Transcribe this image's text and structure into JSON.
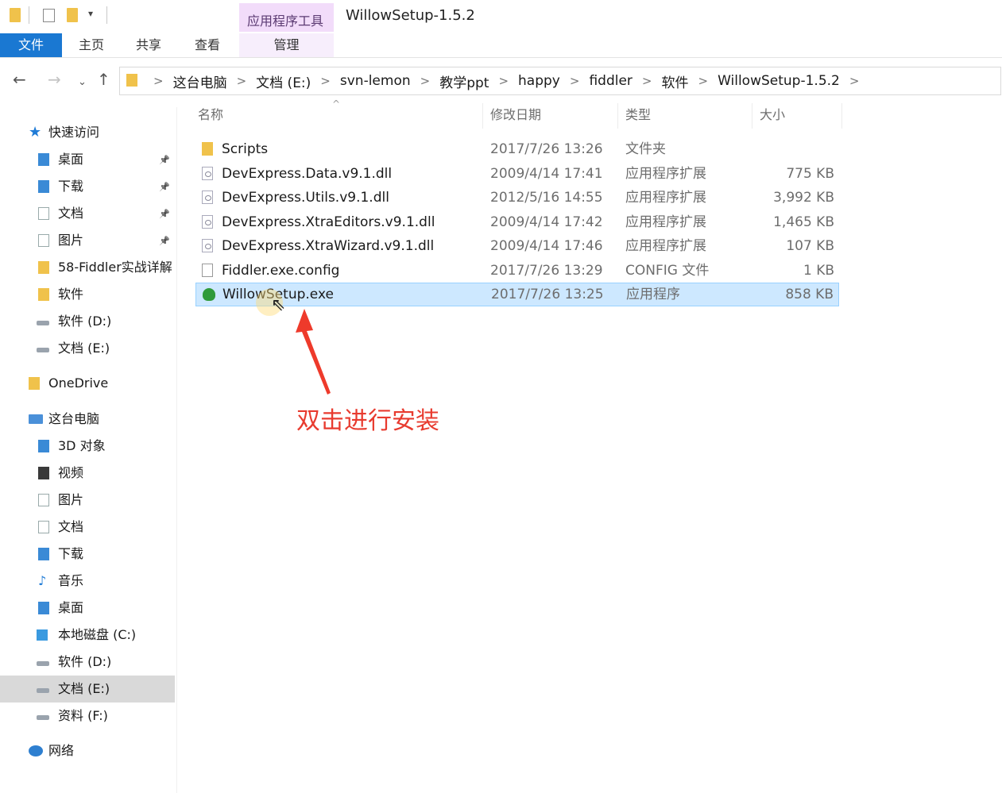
{
  "window": {
    "title": "WillowSetup-1.5.2",
    "context_tab_group": "应用程序工具"
  },
  "ribbon": {
    "tabs": [
      "文件",
      "主页",
      "共享",
      "查看",
      "管理"
    ],
    "active_tab_color": "#1a78d2",
    "context_color": "#f2dcfa"
  },
  "address": {
    "breadcrumbs": [
      "这台电脑",
      "文档 (E:)",
      "svn-lemon",
      "教学ppt",
      "happy",
      "fiddler",
      "软件",
      "WillowSetup-1.5.2"
    ]
  },
  "sidebar": {
    "items": [
      {
        "label": "快速访问",
        "icon": "star-icon"
      },
      {
        "label": "桌面",
        "icon": "desktop-folder-icon",
        "pinned": true
      },
      {
        "label": "下载",
        "icon": "download-folder-icon",
        "pinned": true
      },
      {
        "label": "文档",
        "icon": "documents-folder-icon",
        "pinned": true
      },
      {
        "label": "图片",
        "icon": "pictures-folder-icon",
        "pinned": true
      },
      {
        "label": "58-Fiddler实战详解",
        "icon": "folder-icon"
      },
      {
        "label": "软件",
        "icon": "folder-icon"
      },
      {
        "label": "软件 (D:)",
        "icon": "drive-icon"
      },
      {
        "label": "文档 (E:)",
        "icon": "drive-icon"
      },
      {
        "label": "OneDrive",
        "icon": "onedrive-icon"
      },
      {
        "label": "这台电脑",
        "icon": "computer-icon"
      },
      {
        "label": "3D 对象",
        "icon": "3d-objects-icon"
      },
      {
        "label": "视频",
        "icon": "videos-icon"
      },
      {
        "label": "图片",
        "icon": "pictures-folder-icon"
      },
      {
        "label": "文档",
        "icon": "documents-folder-icon"
      },
      {
        "label": "下载",
        "icon": "download-folder-icon"
      },
      {
        "label": "音乐",
        "icon": "music-icon"
      },
      {
        "label": "桌面",
        "icon": "desktop-folder-icon"
      },
      {
        "label": "本地磁盘 (C:)",
        "icon": "windows-drive-icon"
      },
      {
        "label": "软件 (D:)",
        "icon": "drive-icon"
      },
      {
        "label": "文档 (E:)",
        "icon": "drive-icon",
        "selected": true
      },
      {
        "label": "资料 (F:)",
        "icon": "drive-icon"
      },
      {
        "label": "网络",
        "icon": "network-icon"
      }
    ]
  },
  "file_list": {
    "columns": [
      "名称",
      "修改日期",
      "类型",
      "大小"
    ],
    "rows": [
      {
        "name": "Scripts",
        "date": "2017/7/26 13:26",
        "type": "文件夹",
        "size": "",
        "icon": "folder-icon"
      },
      {
        "name": "DevExpress.Data.v9.1.dll",
        "date": "2009/4/14 17:41",
        "type": "应用程序扩展",
        "size": "775 KB",
        "icon": "dll-file-icon"
      },
      {
        "name": "DevExpress.Utils.v9.1.dll",
        "date": "2012/5/16 14:55",
        "type": "应用程序扩展",
        "size": "3,992 KB",
        "icon": "dll-file-icon"
      },
      {
        "name": "DevExpress.XtraEditors.v9.1.dll",
        "date": "2009/4/14 17:42",
        "type": "应用程序扩展",
        "size": "1,465 KB",
        "icon": "dll-file-icon"
      },
      {
        "name": "DevExpress.XtraWizard.v9.1.dll",
        "date": "2009/4/14 17:46",
        "type": "应用程序扩展",
        "size": "107 KB",
        "icon": "dll-file-icon"
      },
      {
        "name": "Fiddler.exe.config",
        "date": "2017/7/26 13:29",
        "type": "CONFIG 文件",
        "size": "1 KB",
        "icon": "config-file-icon"
      },
      {
        "name": "WillowSetup.exe",
        "date": "2017/7/26 13:25",
        "type": "应用程序",
        "size": "858 KB",
        "icon": "exe-tree-icon",
        "selected": true
      }
    ]
  },
  "annotation": {
    "text": "双击进行安装",
    "color": "#e83b2f"
  }
}
